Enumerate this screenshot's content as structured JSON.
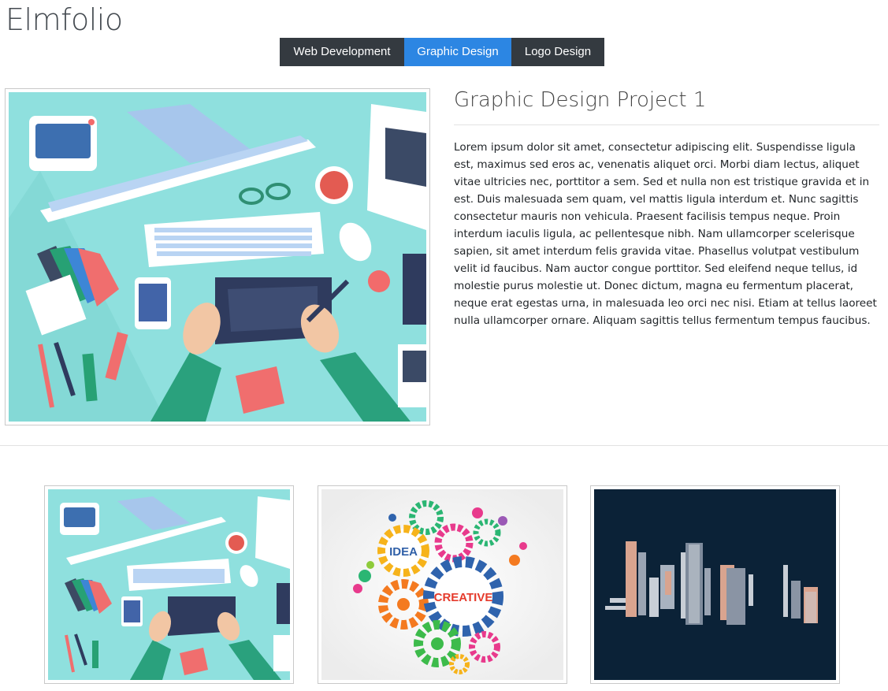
{
  "brand": {
    "title": "Elmfolio"
  },
  "tabs": [
    {
      "label": "Web Development",
      "active": false
    },
    {
      "label": "Graphic Design",
      "active": true
    },
    {
      "label": "Logo Design",
      "active": false
    }
  ],
  "project": {
    "title": "Graphic Design Project 1",
    "description": "Lorem ipsum dolor sit amet, consectetur adipiscing elit. Suspendisse ligula est, maximus sed eros ac, venenatis aliquet orci. Morbi diam lectus, aliquet vitae ultricies nec, porttitor a sem. Sed et nulla non est tristique gravida et in est. Duis malesuada sem quam, vel mattis ligula interdum et. Nunc sagittis consectetur mauris non vehicula. Praesent facilisis tempus neque. Proin interdum iaculis ligula, ac pellentesque nibh. Nam ullamcorper scelerisque sapien, sit amet interdum felis gravida vitae. Phasellus volutpat vestibulum velit id faucibus. Nam auctor congue porttitor. Sed eleifend neque tellus, id molestie purus molestie ut. Donec dictum, magna eu fermentum placerat, neque erat egestas urna, in malesuada leo orci nec nisi. Etiam at tellus laoreet nulla ullamcorper ornare. Aliquam sagittis tellus fermentum tempus faucibus."
  },
  "thumbnails": {
    "gears_words": {
      "idea": "IDEA",
      "creative": "CREATIVE"
    }
  },
  "colors": {
    "tab_bg": "#343a40",
    "tab_active": "#2c86e3",
    "desk_bg": "#8fe0de",
    "city_bg": "#0b2237"
  }
}
